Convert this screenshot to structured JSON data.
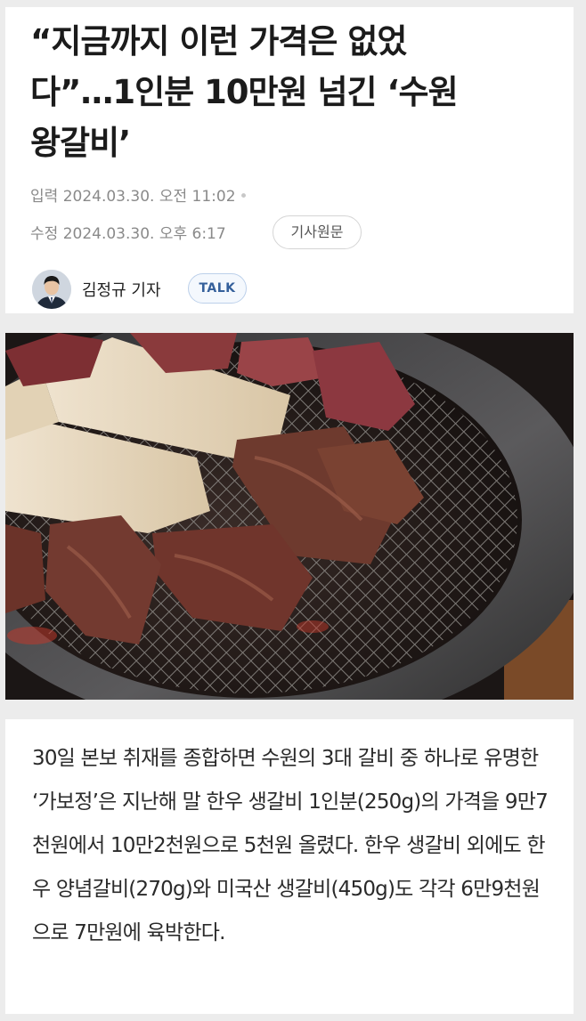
{
  "article": {
    "headline": "“지금까지 이런 가격은 없었\n다”…1인분 10만원 넘긴 ‘수원\n왕갈비’",
    "input_label": "입력",
    "input_time": "2024.03.30. 오전 11:02",
    "edit_label": "수정",
    "edit_time": "2024.03.30. 오후 6:17",
    "original_button": "기사원문",
    "reporter": "김정규 기자",
    "talk_button": "TALK"
  },
  "photo": {
    "subject": "grilled galbi and king oyster mushrooms on a charcoal grill"
  },
  "body": {
    "paragraph": "30일 본보 취재를 종합하면 수원의 3대 갈비 중 하나로 유명한 ‘가보정’은 지난해 말 한우 생갈비 1인분(250g)의 가격을 9만7천원에서 10만2천원으로 5천원 올렸다. 한우 생갈비 외에도 한우 양념갈비(270g)와 미국산 생갈비(450g)도 각각 6만9천원으로 7만원에 육박한다."
  }
}
